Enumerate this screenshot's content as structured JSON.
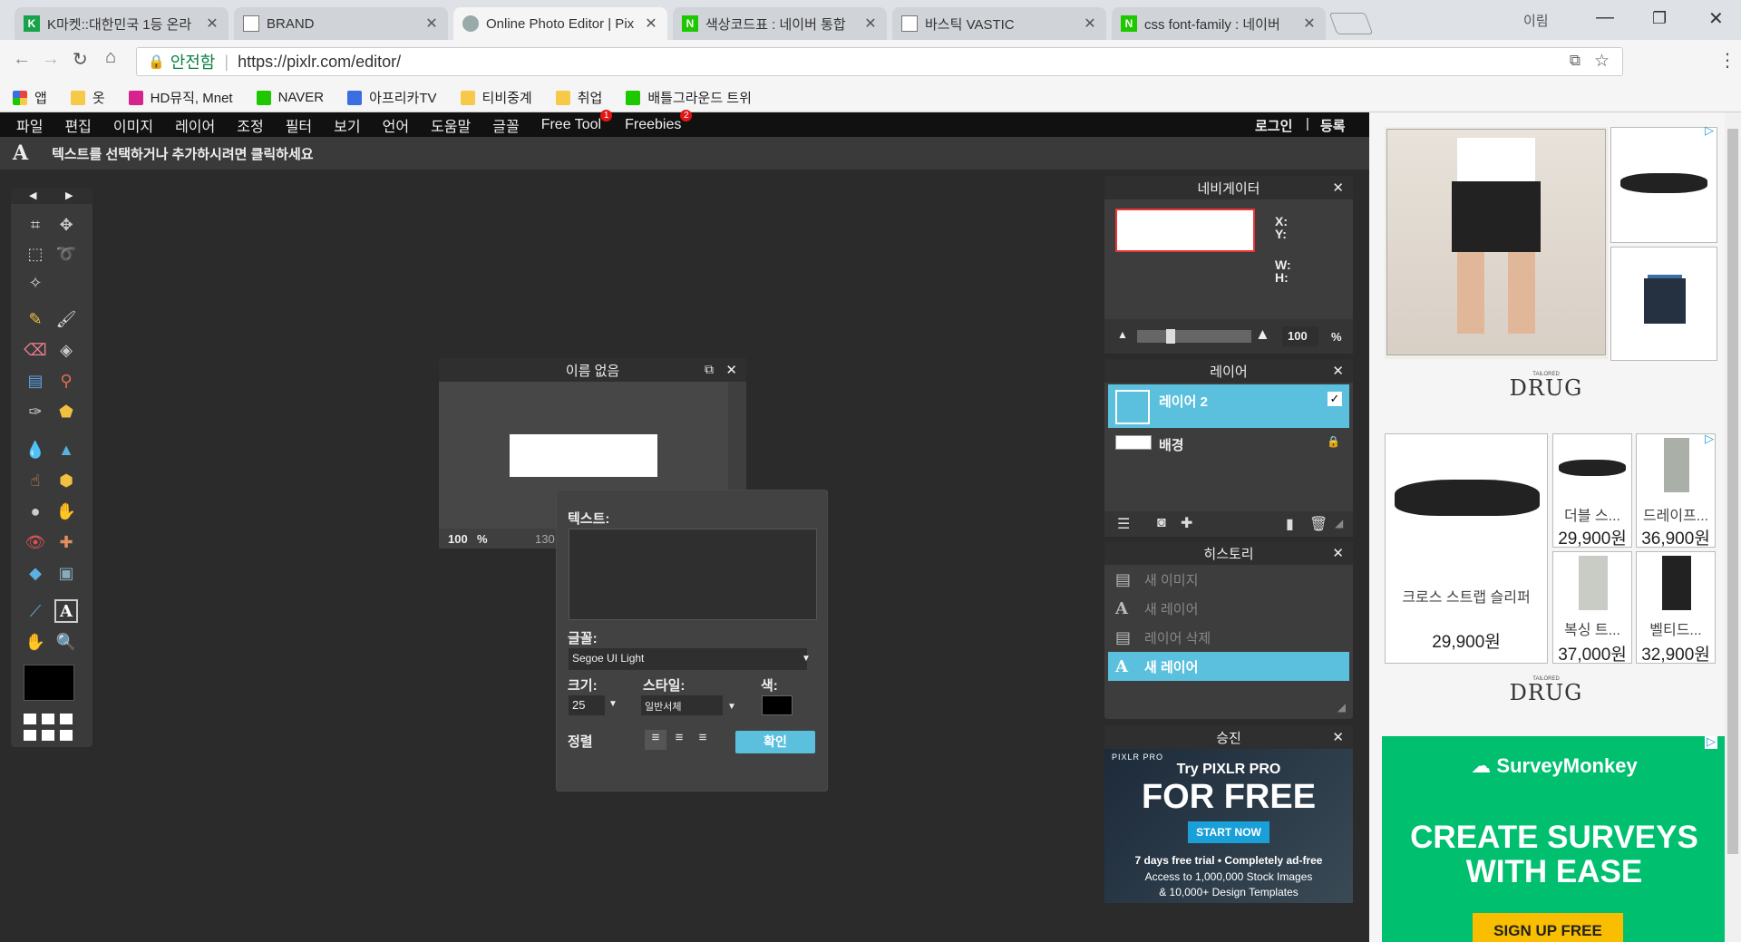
{
  "browser": {
    "tabs": [
      {
        "label": "K마켓::대한민국 1등 온라",
        "icon": "k-icon",
        "color": "#17a34a"
      },
      {
        "label": "BRAND",
        "icon": "page-icon",
        "color": "#888"
      },
      {
        "label": "Online Photo Editor | Pix",
        "icon": "pixlr-icon",
        "color": "#9aa"
      },
      {
        "label": "색상코드표 : 네이버 통합",
        "icon": "naver-icon",
        "color": "#1ec800"
      },
      {
        "label": "바스틱 VASTIC",
        "icon": "page-icon",
        "color": "#888"
      },
      {
        "label": "css font-family : 네이버",
        "icon": "naver-icon",
        "color": "#1ec800"
      }
    ],
    "profile": "이림",
    "secure": "안전함",
    "url": "https://pixlr.com/editor/",
    "bookmarks": [
      {
        "label": "앱",
        "color": "#e8453c"
      },
      {
        "label": "옷",
        "color": "#f7c948"
      },
      {
        "label": "HD뮤직, Mnet",
        "color": "#d6248c"
      },
      {
        "label": "NAVER",
        "color": "#1ec800"
      },
      {
        "label": "아프리카TV",
        "color": "#3b6ee0"
      },
      {
        "label": "티비중계",
        "color": "#f7c948"
      },
      {
        "label": "취업",
        "color": "#f7c948"
      },
      {
        "label": "배틀그라운드 트위",
        "color": "#1ec800"
      }
    ]
  },
  "editor": {
    "menu": [
      {
        "label": "파일"
      },
      {
        "label": "편집"
      },
      {
        "label": "이미지"
      },
      {
        "label": "레이어"
      },
      {
        "label": "조정"
      },
      {
        "label": "필터"
      },
      {
        "label": "보기"
      },
      {
        "label": "언어"
      },
      {
        "label": "도움말"
      },
      {
        "label": "글꼴"
      },
      {
        "label": "Free Tool",
        "badge": "1"
      },
      {
        "label": "Freebies",
        "badge": "2"
      }
    ],
    "login": "로그인",
    "sep": "|",
    "register": "등록",
    "tool_hint_icon": "A",
    "tool_hint": "텍스트를 선택하거나 추가하시려면 클릭하세요",
    "document": {
      "title": "이름 없음",
      "zoom": "100",
      "zoom_unit": "%",
      "size_partial": "130"
    },
    "text_dialog": {
      "text_label": "텍스트:",
      "text_value": "",
      "font_label": "글꼴:",
      "font_value": "Segoe UI Light",
      "size_label": "크기:",
      "size_value": "25",
      "style_label": "스타일:",
      "style_value": "일반서체",
      "color_label": "색:",
      "color_value": "#000000",
      "align_label": "정렬",
      "ok": "확인"
    },
    "navigator": {
      "title": "네비게이터",
      "x": "X:",
      "y": "Y:",
      "w": "W:",
      "h": "H:",
      "zoom": "100",
      "unit": "%"
    },
    "layers": {
      "title": "레이어",
      "items": [
        {
          "name": "레이어 2",
          "selected": true,
          "checked": true
        },
        {
          "name": "배경",
          "selected": false,
          "locked": true
        }
      ]
    },
    "history": {
      "title": "히스토리",
      "items": [
        {
          "icon": "new-image-icon",
          "label": "새 이미지"
        },
        {
          "icon": "A",
          "label": "새 레이어"
        },
        {
          "icon": "delete-layer-icon",
          "label": "레이어 삭제"
        },
        {
          "icon": "A",
          "label": "새 레이어",
          "selected": true
        }
      ]
    },
    "promo": {
      "title": "승진",
      "brand": "PIXLR PRO",
      "line1": "Try PIXLR PRO",
      "line2": "FOR FREE",
      "cta": "START NOW",
      "fine1": "7 days free trial • Completely ad-free",
      "fine2": "Access to 1,000,000 Stock Images",
      "fine3": "& 10,000+ Design Templates"
    }
  },
  "ads": {
    "brand": "DRUG",
    "brand_sub": "TAILORED",
    "products": [
      {
        "name": "크로스 스트랩 슬리퍼",
        "price": "29,900원"
      },
      {
        "name": "더블 스...",
        "price": "29,900원"
      },
      {
        "name": "드레이프...",
        "price": "36,900원"
      },
      {
        "name": "복싱 트...",
        "price": "37,000원"
      },
      {
        "name": "벨티드...",
        "price": "32,900원"
      }
    ],
    "survey": {
      "brand": "SurveyMonkey",
      "headline1": "CREATE SURVEYS",
      "headline2": "WITH EASE",
      "cta": "SIGN UP FREE"
    }
  }
}
